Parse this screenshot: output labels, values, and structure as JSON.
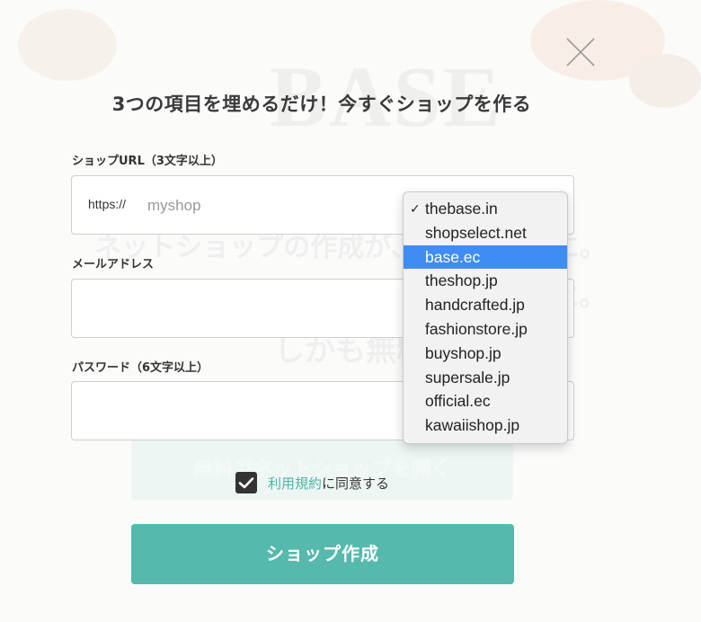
{
  "background": {
    "logo_text": "BASE",
    "line1": "ネットショップの作成が、今すぐ簡単に。",
    "line2": "多彩なデザインテーマで、今すぐ簡単に。",
    "line3": "しかも無料",
    "cta_text": "無料でネットショップを開く"
  },
  "modal": {
    "title": "3つの項目を埋めるだけ！今すぐショップを作る",
    "shop_url": {
      "label": "ショップURL（3文字以上）",
      "prefix": "https://",
      "placeholder": "myshop"
    },
    "email": {
      "label": "メールアドレス",
      "value": ""
    },
    "password": {
      "label": "パスワード（6文字以上）",
      "value": ""
    },
    "domain_dropdown": {
      "options": [
        "thebase.in",
        "shopselect.net",
        "base.ec",
        "theshop.jp",
        "handcrafted.jp",
        "fashionstore.jp",
        "buyshop.jp",
        "supersale.jp",
        "official.ec",
        "kawaiishop.jp"
      ],
      "checked": "thebase.in",
      "highlighted": "base.ec",
      "check_mark": "✓"
    },
    "agree": {
      "checked": true,
      "link_text": "利用規約",
      "suffix": "に同意する"
    },
    "submit_label": "ショップ作成"
  },
  "colors": {
    "accent": "#55b9ad",
    "link": "#4fb3a6",
    "highlight": "#3f8cf5"
  },
  "icons": {
    "close": "close-icon",
    "check": "check-icon"
  }
}
